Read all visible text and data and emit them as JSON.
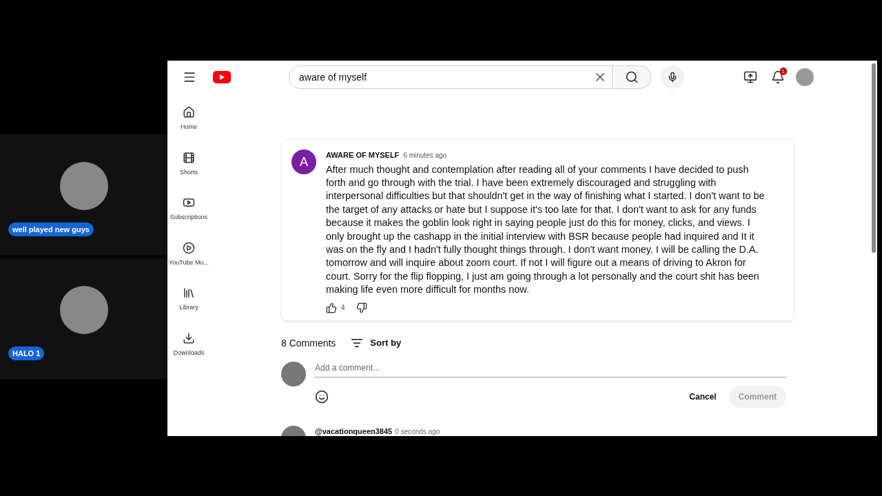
{
  "participants": [
    {
      "name": "well played new guys"
    },
    {
      "name": "HALO 1"
    }
  ],
  "youtube": {
    "search": {
      "value": "aware of myself"
    },
    "notification_count": "1",
    "sidebar": [
      {
        "label": "Home"
      },
      {
        "label": "Shorts"
      },
      {
        "label": "Subscriptions"
      },
      {
        "label": "YouTube Mu..."
      },
      {
        "label": "Library"
      },
      {
        "label": "Downloads"
      }
    ],
    "post": {
      "avatar_letter": "A",
      "author": "AWARE OF MYSELF",
      "time": "6 minutes ago",
      "text": "After much thought and contemplation after reading all of your comments I have decided to push forth and go through with the trial. I have been extremely discouraged and struggling with interpersonal difficulties but that shouldn't get in the way of finishing what I started. I don't want to be the target of any attacks or hate but I suppose it's too late for that. I don't want to ask for any funds because it makes the goblin look right in saying people just do this for money, clicks, and views. I only brought up the cashapp in the initial interview with BSR because people had inquired and It it was on the fly and I hadn't fully thought things through. I don't want money. I will be calling the D.A. tomorrow and will inquire about zoom court. If not I will figure out a means of driving to Akron for court. Sorry for the flip flopping, I just am going through a lot personally and the court shit has been making life even more difficult for months now.",
      "likes": "4"
    },
    "comments_count": "8 Comments",
    "sort_label": "Sort by",
    "new_comment": {
      "placeholder": "Add a comment...",
      "cancel": "Cancel",
      "submit": "Comment"
    },
    "comments": [
      {
        "author": "@vacationqueen3845",
        "time": "0 seconds ago"
      }
    ]
  }
}
